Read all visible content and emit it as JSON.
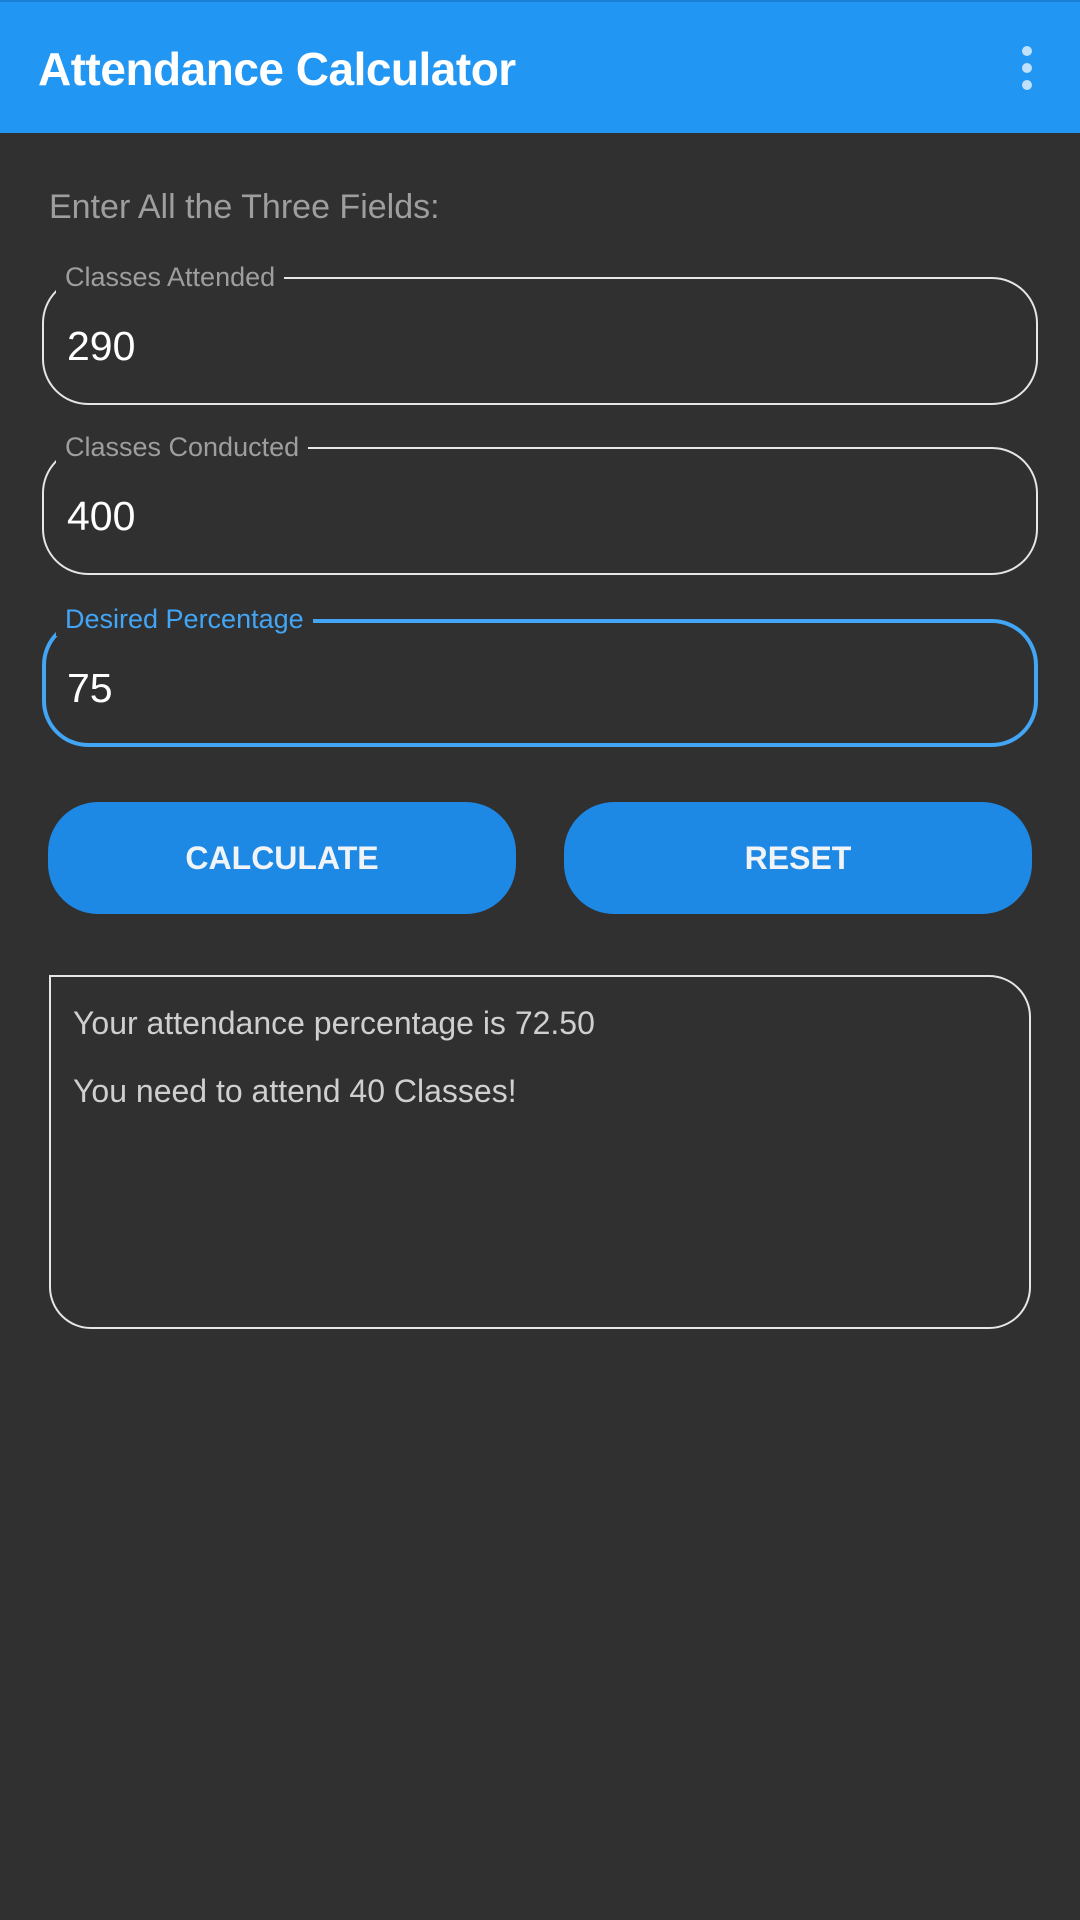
{
  "appbar": {
    "title": "Attendance Calculator",
    "menu_icon": "more-vert-icon"
  },
  "form": {
    "instruction": "Enter All the Three Fields:",
    "fields": [
      {
        "label": "Classes Attended",
        "value": "290",
        "focused": false
      },
      {
        "label": "Classes Conducted",
        "value": "400",
        "focused": false
      },
      {
        "label": "Desired Percentage",
        "value": "75",
        "focused": true
      }
    ]
  },
  "buttons": {
    "calculate": "CALCULATE",
    "reset": "RESET"
  },
  "result": {
    "line1": "Your attendance percentage is 72.50",
    "line2": "You need to attend 40 Classes!"
  },
  "colors": {
    "appbar": "#2196f3",
    "button": "#1e88e5",
    "focus": "#42a5f5",
    "background": "#303030"
  }
}
